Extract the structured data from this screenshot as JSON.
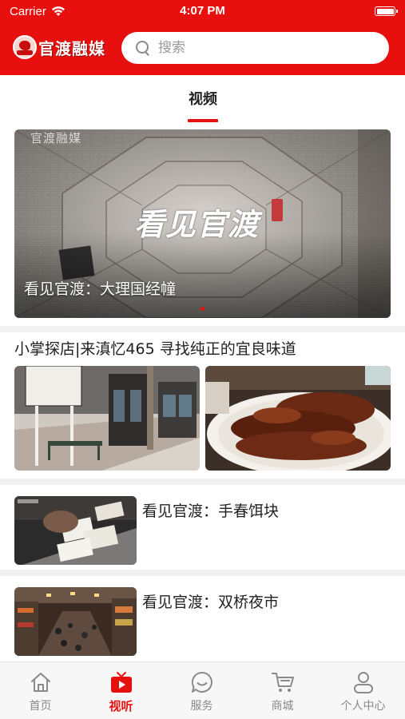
{
  "status_bar": {
    "carrier": "Carrier",
    "time": "4:07 PM"
  },
  "header": {
    "logo_text": "官渡融媒",
    "search_placeholder": "搜索"
  },
  "tabs": [
    {
      "label": "视频",
      "active": true
    }
  ],
  "banner": {
    "watermark": "官渡融媒",
    "calligraphy": "看见官渡",
    "caption": "看见官渡：大理国经幢"
  },
  "feed": {
    "article": {
      "title": "小掌探店|来滇忆465 寻找纯正的宜良味道"
    },
    "items": [
      {
        "title": "看见官渡：手春饵块"
      },
      {
        "title": "看见官渡：双桥夜市"
      }
    ]
  },
  "bottom_nav": [
    {
      "label": "首页",
      "icon": "home-icon",
      "active": false
    },
    {
      "label": "视听",
      "icon": "tv-play-icon",
      "active": true
    },
    {
      "label": "服务",
      "icon": "chat-bubble-icon",
      "active": false
    },
    {
      "label": "商城",
      "icon": "cart-icon",
      "active": false
    },
    {
      "label": "个人中心",
      "icon": "person-icon",
      "active": false
    }
  ],
  "colors": {
    "brand_red": "#e8100f",
    "inactive_gray": "#8a8a8a"
  }
}
